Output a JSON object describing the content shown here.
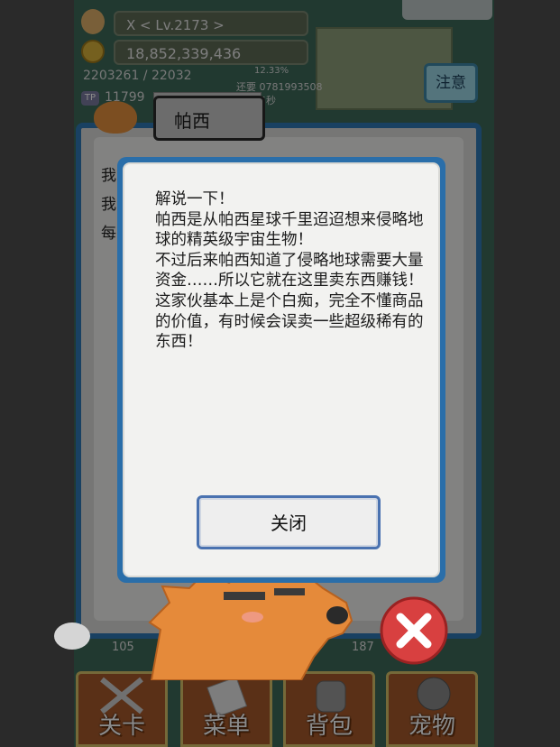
{
  "hud": {
    "level": "X    < Lv.2173 >",
    "gold": "18,852,339,436",
    "hp": "2203261 / 22032",
    "tp": "11799",
    "tp_label": "TP",
    "percent": "12.33%",
    "remaining": "还要 0781993508",
    "seconds": "5秒",
    "notice_button": "注意"
  },
  "speaker": {
    "name": "帕西",
    "lines": [
      "我",
      "我",
      "每"
    ]
  },
  "dialog": {
    "paragraphs": [
      "解说一下！",
      "帕西是从帕西星球千里迢迢想来侵略地球的精英级宇宙生物！",
      "不过后来帕西知道了侵略地球需要大量资金……所以它就在这里卖东西赚钱！",
      "这家伙基本上是个白痴，完全不懂商品的价值，有时候会误卖一些超级稀有的东西！"
    ],
    "close_button": "关闭"
  },
  "bottom_counts": {
    "left": "105",
    "right": "187"
  },
  "menu": [
    {
      "label": "关卡",
      "icon": "crossed-swords-icon"
    },
    {
      "label": "菜单",
      "icon": "notepad-icon"
    },
    {
      "label": "背包",
      "icon": "backpack-icon"
    },
    {
      "label": "宠物",
      "icon": "pet-icon"
    }
  ],
  "colors": {
    "dialog_border": "#2a6ea9",
    "speech_border": "#2f79b5",
    "notice_bg": "#9bd7e6",
    "close_x": "#d84040"
  }
}
